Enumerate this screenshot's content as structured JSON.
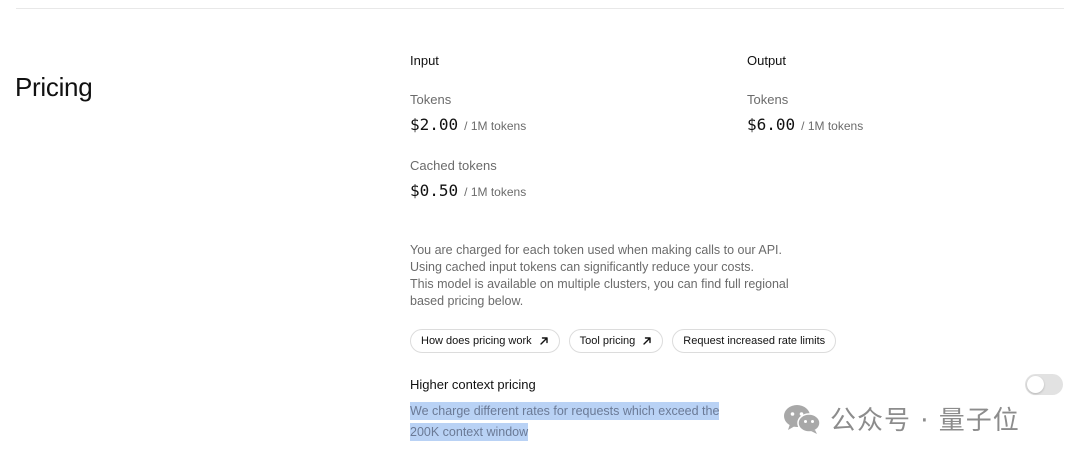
{
  "section": {
    "title": "Pricing"
  },
  "input": {
    "heading": "Input",
    "tokens": {
      "label": "Tokens",
      "price": "$2.00",
      "unit": "/ 1M tokens"
    },
    "cached": {
      "label": "Cached tokens",
      "price": "$0.50",
      "unit": "/ 1M tokens"
    }
  },
  "output": {
    "heading": "Output",
    "tokens": {
      "label": "Tokens",
      "price": "$6.00",
      "unit": "/ 1M tokens"
    }
  },
  "description": {
    "lines": [
      "You are charged for each token used when making calls to our API.",
      "Using cached input tokens can significantly reduce your costs.",
      "This model is available on multiple clusters, you can find full regional",
      "based pricing below."
    ]
  },
  "links": [
    {
      "label": "How does pricing work",
      "icon": "arrow-up-right-icon"
    },
    {
      "label": "Tool pricing",
      "icon": "arrow-up-right-icon"
    },
    {
      "label": "Request increased rate limits"
    }
  ],
  "higher_context": {
    "title": "Higher context pricing",
    "line1": "We charge different rates for requests which exceed the",
    "line2": "200K context window",
    "toggle_on": false
  },
  "watermark": {
    "text": "公众号 · 量子位",
    "icon": "wechat-icon"
  },
  "colors": {
    "highlight": "#b9d2f5",
    "muted_text": "#6b6b6b",
    "toggle_off": "#e2e2e2"
  }
}
